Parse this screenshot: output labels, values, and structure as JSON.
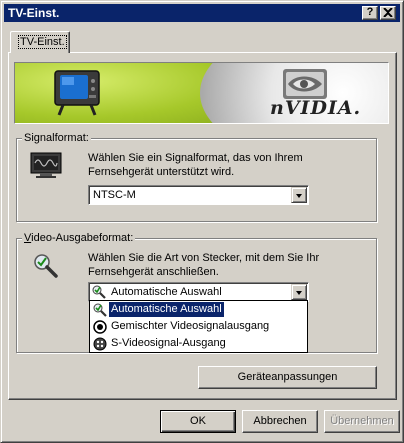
{
  "window": {
    "title": "TV-Einst.",
    "help_button": "?",
    "close_button": "✕"
  },
  "tabs": [
    {
      "label": "TV-Einst.",
      "active": true
    }
  ],
  "banner": {
    "brand": "nVIDIA."
  },
  "signal_format": {
    "legend": "Signalformat:",
    "description": "Wählen Sie ein Signalformat, das von Ihrem Fernsehgerät unterstützt wird.",
    "selected": "NTSC-M"
  },
  "video_output": {
    "legend": "Video-Ausgabeformat:",
    "description": "Wählen Sie die Art von Stecker, mit dem Sie Ihr Fernsehgerät anschließen.",
    "selected": "Automatische Auswahl",
    "options": [
      {
        "label": "Automatische Auswahl",
        "icon": "auto-select-icon",
        "selected": true
      },
      {
        "label": "Gemischter Videosignalausgang",
        "icon": "composite-connector-icon",
        "selected": false
      },
      {
        "label": "S-Videosignal-Ausgang",
        "icon": "svideo-connector-icon",
        "selected": false
      }
    ]
  },
  "buttons": {
    "device_adjustments": "Geräteanpassungen",
    "ok": "OK",
    "cancel": "Abbrechen",
    "apply": "Übernehmen"
  },
  "colors": {
    "titlebar": "#0a246a",
    "selection": "#0a246a",
    "dialog_face": "#d4d0c8",
    "banner_green": "#a8c828"
  }
}
